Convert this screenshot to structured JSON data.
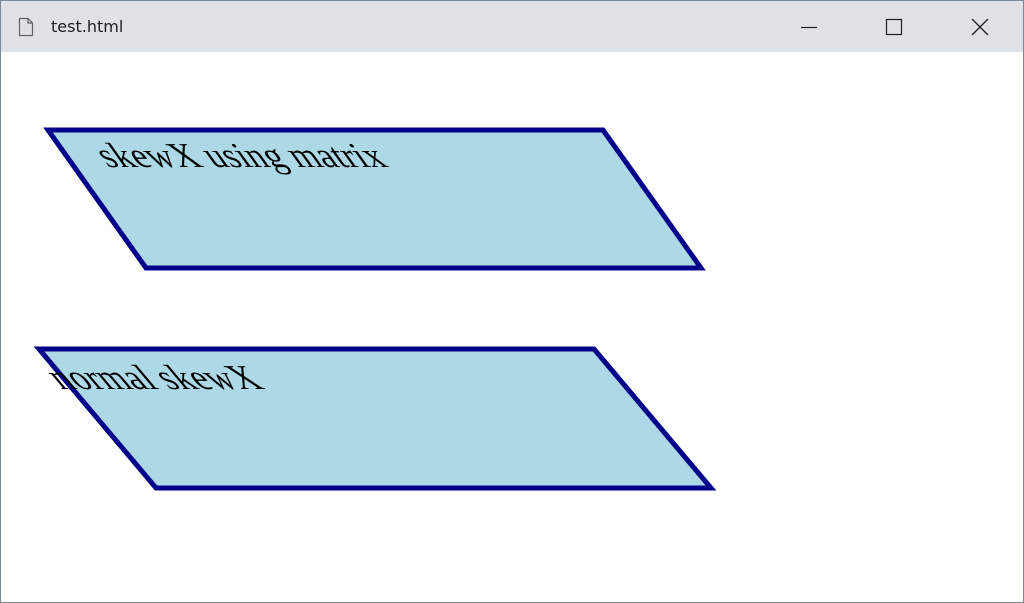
{
  "window": {
    "title": "test.html",
    "icon": "file-icon",
    "controls": [
      "minimize-icon",
      "maximize-icon",
      "close-icon"
    ]
  },
  "shapes": [
    {
      "label": "skewX using matrix"
    },
    {
      "label": "normal skewX"
    }
  ],
  "colors": {
    "fill": "#add8e6",
    "stroke": "#00008b",
    "titlebar": "#dee1e6"
  }
}
